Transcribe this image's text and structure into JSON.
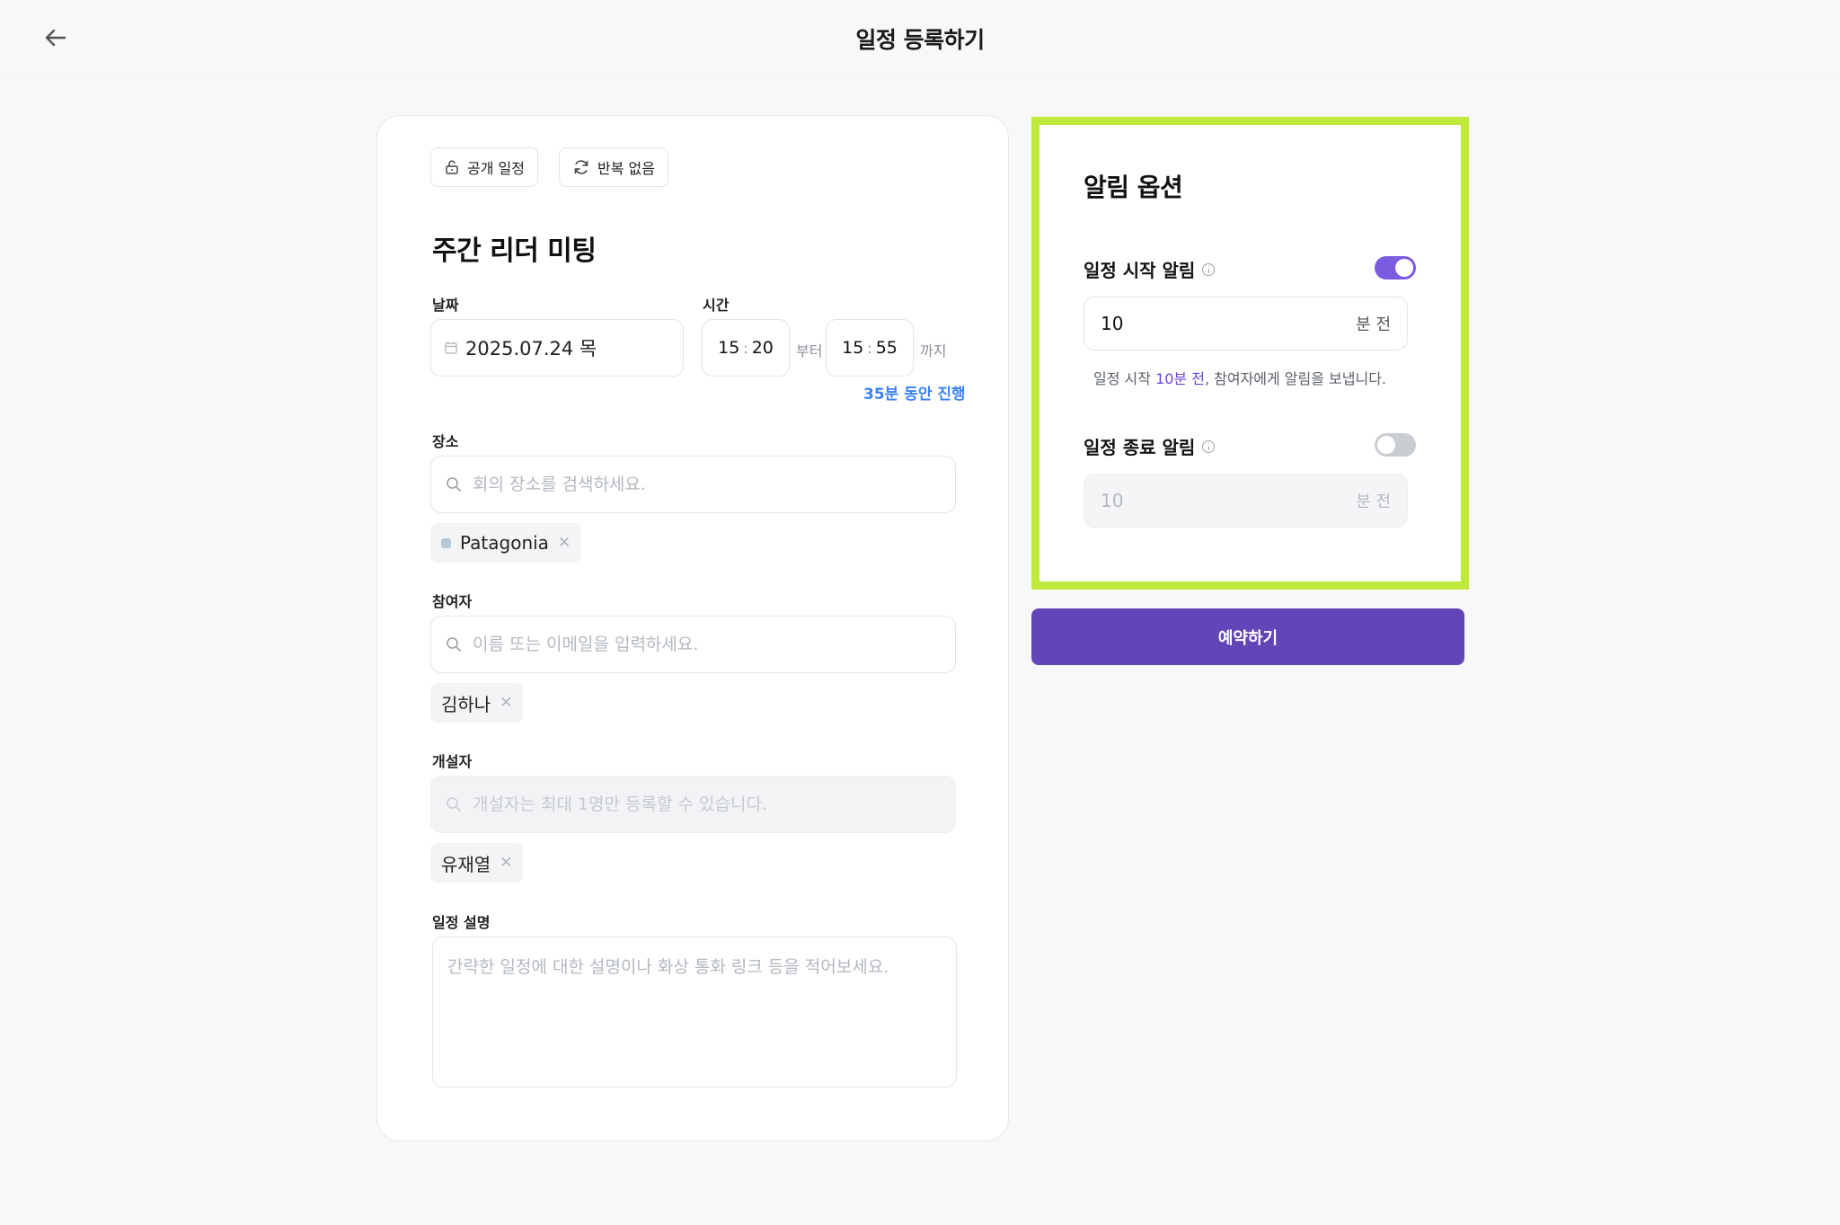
{
  "header": {
    "title": "일정 등록하기",
    "back_icon": "arrow-left-icon"
  },
  "form": {
    "visibility_label": "공개 일정",
    "repeat_label": "반복 없음",
    "event_title": "주간 리더 미팅",
    "date_label": "날짜",
    "date_value": "2025.07.24 목",
    "time_label": "시간",
    "start_hour": "15",
    "start_minute": "20",
    "from_text": "부터",
    "end_hour": "15",
    "end_minute": "55",
    "to_text": "까지",
    "duration_text": "35분 동안 진행",
    "location_label": "장소",
    "location_placeholder": "회의 장소를 검색하세요.",
    "location_tag": "Patagonia",
    "participants_label": "참여자",
    "participants_placeholder": "이름 또는 이메일을 입력하세요.",
    "participant_tag": "김하나",
    "organizer_label": "개설자",
    "organizer_placeholder": "개설자는 최대 1명만 등록할 수 있습니다.",
    "organizer_tag": "유재열",
    "description_label": "일정 설명",
    "description_placeholder": "간략한 일정에 대한 설명이나 화상 통화 링크 등을 적어보세요."
  },
  "alarm": {
    "title": "알림 옵션",
    "start_label": "일정 시작 알림",
    "start_enabled": true,
    "start_minutes": "10",
    "start_unit": "분 전",
    "hint_prefix": "일정 시작 ",
    "hint_accent": "10분 전",
    "hint_suffix": ", 참여자에게 알림을 보냅니다.",
    "end_label": "일정 종료 알림",
    "end_enabled": false,
    "end_minutes": "10",
    "end_unit": "분 전"
  },
  "submit_label": "예약하기",
  "colors": {
    "accent_purple": "#6246b8",
    "toggle_on": "#7b5ce0",
    "highlight_border": "#bfe93b",
    "duration_blue": "#3b82f6"
  }
}
